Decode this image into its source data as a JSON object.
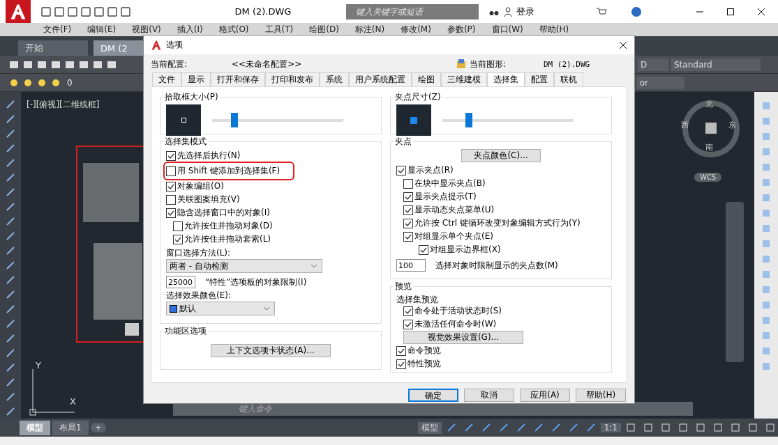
{
  "app": {
    "title": "DM (2).DWG",
    "search_placeholder": "键入关键字或短语",
    "login": "登录",
    "menu": [
      "文件(F)",
      "编辑(E)",
      "视图(V)",
      "插入(I)",
      "格式(O)",
      "工具(T)",
      "绘图(D)",
      "标注(N)",
      "修改(M)",
      "参数(P)",
      "窗口(W)",
      "帮助(H)"
    ],
    "doc_tabs": [
      {
        "label": "开始",
        "selected": false
      },
      {
        "label": "DM (2",
        "selected": true
      }
    ],
    "layer": "0",
    "field_d": "D",
    "text_style": "Standard",
    "field_or": "or",
    "viewport_label": "[-][俯视][二维线框]",
    "viewcube": {
      "north": "北",
      "south": "南",
      "west": "西",
      "east": "东",
      "ucs": "WCS"
    },
    "axes": {
      "x": "X",
      "y": "Y"
    },
    "command_placeholder": "键入命令",
    "layout_tabs": [
      {
        "label": "模型",
        "selected": true
      },
      {
        "label": "布局1",
        "selected": false
      }
    ],
    "add_layout": "+",
    "status": {
      "model": "模型",
      "scale": "1:1"
    }
  },
  "dialog": {
    "title": "选项",
    "profile_label": "当前配置:",
    "profile": "<<未命名配置>>",
    "drawing_label": "当前图形:",
    "drawing": "DM (2).DWG",
    "tabs": [
      {
        "label": "文件",
        "selected": false
      },
      {
        "label": "显示",
        "selected": false
      },
      {
        "label": "打开和保存",
        "selected": false
      },
      {
        "label": "打印和发布",
        "selected": false
      },
      {
        "label": "系统",
        "selected": false
      },
      {
        "label": "用户系统配置",
        "selected": false
      },
      {
        "label": "绘图",
        "selected": false
      },
      {
        "label": "三维建模",
        "selected": false
      },
      {
        "label": "选择集",
        "selected": true
      },
      {
        "label": "配置",
        "selected": false
      },
      {
        "label": "联机",
        "selected": false
      }
    ],
    "pickbox": {
      "title": "拾取框大小(P)",
      "level": 0.17
    },
    "selection_mode": {
      "title": "选择集模式",
      "items": [
        {
          "label": "先选择后执行(N)",
          "checked": true,
          "highlighted": false
        },
        {
          "label": "用 Shift 键添加到选择集(F)",
          "checked": false,
          "highlighted": true
        },
        {
          "label": "对象编组(O)",
          "checked": true,
          "highlighted": false
        },
        {
          "label": "关联图案填充(V)",
          "checked": false,
          "highlighted": false
        },
        {
          "label": "隐含选择窗口中的对象(I)",
          "checked": true,
          "highlighted": false,
          "children": [
            {
              "label": "允许按住并拖动对象(D)",
              "checked": false,
              "highlighted": false
            },
            {
              "label": "允许按住并拖动套索(L)",
              "checked": true,
              "highlighted": false
            }
          ]
        }
      ],
      "window_method": {
        "label": "窗口选择方法(L):",
        "value": "两者 - 自动检测"
      },
      "object_limit": {
        "value": "25000",
        "label": "“特性”选项板的对象限制(I)"
      },
      "effect_color": {
        "label": "选择效果颜色(E):",
        "value": "默认"
      }
    },
    "ribbon": {
      "title": "功能区选项",
      "button": "上下文选项卡状态(A)..."
    },
    "grip_size": {
      "title": "夹点尺寸(Z)",
      "level": 0.2
    },
    "grips": {
      "title": "夹点",
      "color_button": "夹点颜色(C)...",
      "items": [
        {
          "label": "显示夹点(R)",
          "checked": true,
          "children": [
            {
              "label": "在块中显示夹点(B)",
              "checked": false
            },
            {
              "label": "显示夹点提示(T)",
              "checked": true
            },
            {
              "label": "显示动态夹点菜单(U)",
              "checked": true
            },
            {
              "label": "允许按 Ctrl 键循环改变对象编辑方式行为(Y)",
              "checked": true
            },
            {
              "label": "对组显示单个夹点(E)",
              "checked": true,
              "children": [
                {
                  "label": "对组显示边界框(X)",
                  "checked": true
                }
              ]
            }
          ]
        }
      ],
      "limit": {
        "value": "100",
        "label": "选择对象时限制显示的夹点数(M)"
      }
    },
    "preview": {
      "title": "预览",
      "subtitle": "选择集预览",
      "sub_items": [
        {
          "label": "命令处于活动状态时(S)",
          "checked": true
        },
        {
          "label": "未激活任何命令时(W)",
          "checked": true
        }
      ],
      "button": "视觉效果设置(G)...",
      "items": [
        {
          "label": "命令预览",
          "checked": true
        },
        {
          "label": "特性预览",
          "checked": true
        }
      ]
    },
    "buttons": [
      {
        "label": "确定",
        "default": true
      },
      {
        "label": "取消",
        "default": false
      },
      {
        "label": "应用(A)",
        "default": false
      },
      {
        "label": "帮助(H)",
        "default": false
      }
    ]
  }
}
